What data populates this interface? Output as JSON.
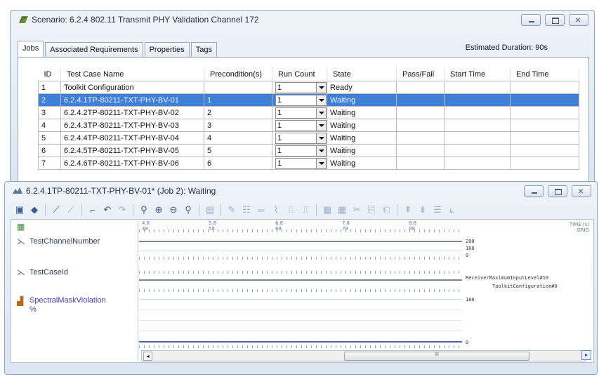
{
  "window1": {
    "title": "Scenario: 6.2.4 802.11 Transmit PHY Validation Channel 172",
    "tabs": [
      "Jobs",
      "Associated Requirements",
      "Properties",
      "Tags"
    ],
    "estimated_duration": "Estimated Duration: 90s",
    "columns": [
      "ID",
      "Test Case Name",
      "Precondition(s)",
      "Run Count",
      "State",
      "Pass/Fail",
      "Start Time",
      "End Time"
    ],
    "rows": [
      {
        "id": "1",
        "name": "Toolkit Configuration",
        "pre": "",
        "run": "1",
        "state": "Ready"
      },
      {
        "id": "2",
        "name": "6.2.4.1TP-80211-TXT-PHY-BV-01",
        "pre": "1",
        "run": "1",
        "state": "Waiting"
      },
      {
        "id": "3",
        "name": "6.2.4.2TP-80211-TXT-PHY-BV-02",
        "pre": "2",
        "run": "1",
        "state": "Waiting"
      },
      {
        "id": "4",
        "name": "6.2.4.3TP-80211-TXT-PHY-BV-03",
        "pre": "3",
        "run": "1",
        "state": "Waiting"
      },
      {
        "id": "5",
        "name": "6.2.4.4TP-80211-TXT-PHY-BV-04",
        "pre": "4",
        "run": "1",
        "state": "Waiting"
      },
      {
        "id": "6",
        "name": "6.2.4.5TP-80211-TXT-PHY-BV-05",
        "pre": "5",
        "run": "1",
        "state": "Waiting"
      },
      {
        "id": "7",
        "name": "6.2.4.6TP-80211-TXT-PHY-BV-06",
        "pre": "6",
        "run": "1",
        "state": "Waiting"
      }
    ]
  },
  "window2": {
    "title": "6.2.4.1TP-80211-TXT-PHY-BV-01* (Job 2): Waiting",
    "time_marks": [
      "4.8\n48",
      "5.8\n58",
      "6.8\n68",
      "7.8\n78",
      "8.8\n88"
    ],
    "axis_caption": "TIME (s)\nGRID",
    "signals": {
      "s1": "TestChannelNumber",
      "s2": "TestCaseId",
      "s3": "SpectralMaskViolation",
      "s3_unit": "%"
    },
    "values": {
      "ch_a": "200",
      "ch_b": "100",
      "ch_c": "0",
      "case_a": "ReceiverMaximumInputLevel#10",
      "case_b": "ToolkitConfiguration#0",
      "spec_a": "100",
      "spec_b": "0"
    },
    "scroll_center": "III"
  },
  "colors": {
    "selected_row": "#3f7fd6",
    "window_border": "#8ea5bf"
  }
}
